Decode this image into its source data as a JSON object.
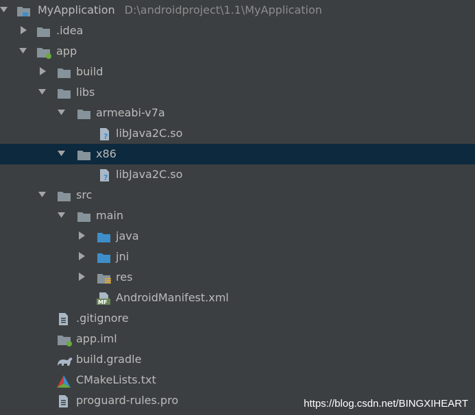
{
  "tree": {
    "project": {
      "name": "MyApplication",
      "path": "D:\\androidproject\\1.1\\MyApplication"
    },
    "idea": ".idea",
    "app": "app",
    "build": "build",
    "libs": "libs",
    "armeabi": "armeabi-v7a",
    "lib1": "libJava2C.so",
    "x86": "x86",
    "lib2": "libJava2C.so",
    "src": "src",
    "main": "main",
    "java": "java",
    "jni": "jni",
    "res": "res",
    "manifest": "AndroidManifest.xml",
    "gitignore": ".gitignore",
    "appiml": "app.iml",
    "buildgradle": "build.gradle",
    "cmake": "CMakeLists.txt",
    "proguard": "proguard-rules.pro"
  },
  "watermark": "https://blog.csdn.net/BINGXIHEART",
  "icons": {
    "folder": "folder-icon",
    "module_folder": "module-folder-icon",
    "source_folder": "source-folder-icon",
    "resource_folder": "resource-folder-icon",
    "unknown_file": "unknown-file-icon",
    "manifest": "manifest-icon",
    "text_file": "text-file-icon",
    "gradle": "gradle-icon",
    "cmake": "cmake-icon"
  },
  "colors": {
    "background": "#3c3f41",
    "selection": "#0d293e",
    "text": "#bbbbbb",
    "path_text": "#8c8c8c",
    "folder": "#87939a",
    "source_folder": "#3d8ec9",
    "module_dot": "#6aab3c"
  }
}
